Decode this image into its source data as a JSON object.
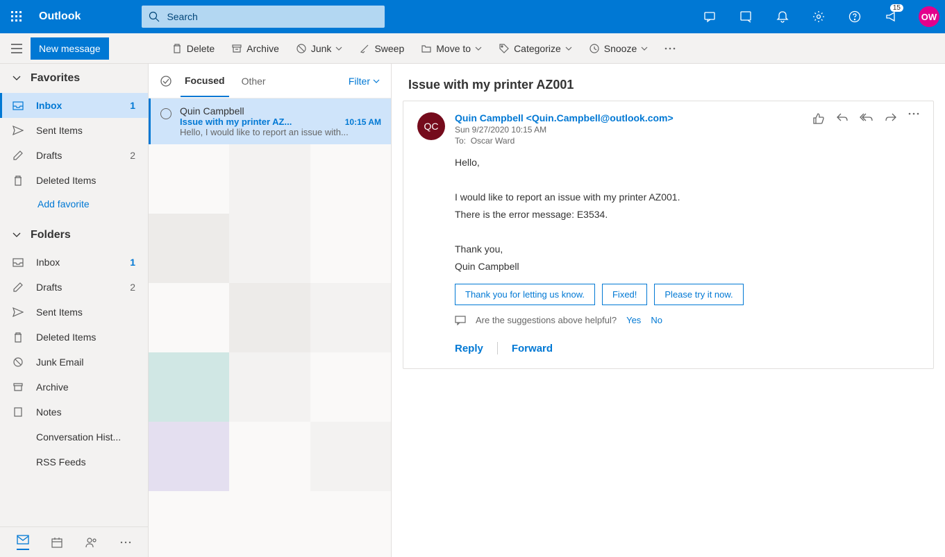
{
  "header": {
    "app_name": "Outlook",
    "search_placeholder": "Search",
    "notification_badge": "15",
    "avatar_initials": "OW"
  },
  "commandbar": {
    "new_message": "New message",
    "delete": "Delete",
    "archive": "Archive",
    "junk": "Junk",
    "sweep": "Sweep",
    "move_to": "Move to",
    "categorize": "Categorize",
    "snooze": "Snooze"
  },
  "sidebar": {
    "favorites_header": "Favorites",
    "folders_header": "Folders",
    "add_favorite": "Add favorite",
    "favorites": [
      {
        "label": "Inbox",
        "count": "1",
        "active": true
      },
      {
        "label": "Sent Items"
      },
      {
        "label": "Drafts",
        "count": "2"
      },
      {
        "label": "Deleted Items"
      }
    ],
    "folders": [
      {
        "label": "Inbox",
        "count": "1"
      },
      {
        "label": "Drafts",
        "count": "2"
      },
      {
        "label": "Sent Items"
      },
      {
        "label": "Deleted Items"
      },
      {
        "label": "Junk Email"
      },
      {
        "label": "Archive"
      },
      {
        "label": "Notes"
      },
      {
        "label": "Conversation Hist..."
      },
      {
        "label": "RSS Feeds"
      }
    ]
  },
  "msglist": {
    "tab_focused": "Focused",
    "tab_other": "Other",
    "filter": "Filter",
    "items": [
      {
        "sender": "Quin Campbell",
        "subject": "Issue with my printer AZ...",
        "time": "10:15 AM",
        "preview": "Hello, I would like to report an issue with..."
      }
    ]
  },
  "reading": {
    "subject": "Issue with my printer AZ001",
    "sender_initials": "QC",
    "sender_display": "Quin Campbell <Quin.Campbell@outlook.com>",
    "sent_date": "Sun 9/27/2020 10:15 AM",
    "to_label": "To:",
    "to_value": "Oscar Ward",
    "body_lines": [
      "Hello,",
      "",
      "I would like to report an issue with my printer AZ001.",
      "There is the error message: E3534.",
      "",
      "Thank you,",
      "Quin Campbell"
    ],
    "suggestions": [
      "Thank you for letting us know.",
      "Fixed!",
      "Please try it now."
    ],
    "feedback_prompt": "Are the suggestions above helpful?",
    "feedback_yes": "Yes",
    "feedback_no": "No",
    "reply": "Reply",
    "forward": "Forward"
  }
}
